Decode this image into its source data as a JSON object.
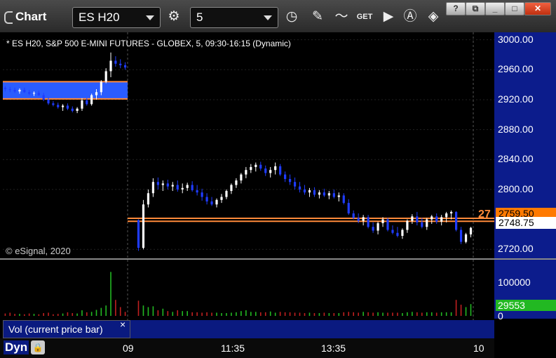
{
  "titlebar": {
    "title": "Chart",
    "symbol": "ES H20",
    "interval": "5",
    "icons": [
      "settings-gear-icon",
      "clock-icon",
      "pencil-icon",
      "studies-icon",
      "get-icon",
      "play-icon",
      "alert-icon",
      "tag-icon"
    ],
    "help_label": "?",
    "window_buttons": [
      "restore",
      "minimize",
      "maximize",
      "close"
    ]
  },
  "chart": {
    "description": "* ES H20, S&P 500 E-MINI FUTURES - GLOBEX, 5, 09:30-16:15 (Dynamic)",
    "copyright": "© eSignal, 2020",
    "price_axis": [
      "3000.00",
      "2960.00",
      "2920.00",
      "2880.00",
      "2840.00",
      "2800.00",
      "2720.00"
    ],
    "price_range": [
      2708,
      3010
    ],
    "last_price": "2748.75",
    "orange_label": "2759.50",
    "orange_left_label": "27",
    "volume_axis": [
      "100000",
      "0"
    ],
    "volume_range": [
      0,
      130000
    ],
    "volume_last": "29553",
    "time_labels": [
      "09",
      "11:35",
      "13:35",
      "10"
    ],
    "vol_panel_label": "Vol (current price bar)",
    "vol_close": "×",
    "dyn_label": "Dyn",
    "colors": {
      "up": "#ffffff",
      "down": "#1f3cff",
      "vol_up": "#22b822",
      "vol_down": "#c02020",
      "zone": "#2a5cff",
      "line": "#ff8a3a"
    }
  },
  "chart_data": {
    "type": "candlestick",
    "series": [
      {
        "name": "day1",
        "candles": [
          [
            2936,
            2938,
            2931,
            2934
          ],
          [
            2934,
            2937,
            2930,
            2933
          ],
          [
            2933,
            2936,
            2929,
            2931
          ],
          [
            2931,
            2935,
            2928,
            2933
          ],
          [
            2933,
            2936,
            2929,
            2930
          ],
          [
            2930,
            2933,
            2926,
            2928
          ],
          [
            2928,
            2931,
            2925,
            2929
          ],
          [
            2929,
            2932,
            2925,
            2926
          ],
          [
            2926,
            2929,
            2918,
            2920
          ],
          [
            2920,
            2923,
            2913,
            2915
          ],
          [
            2915,
            2918,
            2911,
            2913
          ],
          [
            2913,
            2916,
            2908,
            2910
          ],
          [
            2910,
            2914,
            2905,
            2912
          ],
          [
            2912,
            2915,
            2906,
            2908
          ],
          [
            2908,
            2911,
            2903,
            2905
          ],
          [
            2905,
            2910,
            2902,
            2908
          ],
          [
            2908,
            2922,
            2905,
            2919
          ],
          [
            2919,
            2922,
            2912,
            2914
          ],
          [
            2914,
            2928,
            2912,
            2926
          ],
          [
            2926,
            2934,
            2920,
            2930
          ],
          [
            2930,
            2946,
            2926,
            2944
          ],
          [
            2944,
            2962,
            2942,
            2958
          ],
          [
            2958,
            2983,
            2950,
            2972
          ],
          [
            2972,
            2978,
            2964,
            2968
          ],
          [
            2968,
            2974,
            2962,
            2966
          ],
          [
            2966,
            2970,
            2960,
            2963
          ]
        ]
      },
      {
        "name": "day2",
        "candles": [
          [
            2759,
            2760,
            2718,
            2722
          ],
          [
            2722,
            2786,
            2720,
            2780
          ],
          [
            2780,
            2800,
            2776,
            2795
          ],
          [
            2795,
            2815,
            2790,
            2810
          ],
          [
            2810,
            2816,
            2800,
            2806
          ],
          [
            2806,
            2812,
            2798,
            2808
          ],
          [
            2808,
            2813,
            2800,
            2804
          ],
          [
            2804,
            2810,
            2798,
            2806
          ],
          [
            2806,
            2812,
            2797,
            2800
          ],
          [
            2800,
            2808,
            2795,
            2802
          ],
          [
            2802,
            2809,
            2798,
            2806
          ],
          [
            2806,
            2811,
            2797,
            2799
          ],
          [
            2799,
            2806,
            2792,
            2796
          ],
          [
            2796,
            2801,
            2785,
            2790
          ],
          [
            2790,
            2795,
            2780,
            2784
          ],
          [
            2784,
            2790,
            2778,
            2780
          ],
          [
            2780,
            2788,
            2776,
            2786
          ],
          [
            2786,
            2794,
            2782,
            2790
          ],
          [
            2790,
            2800,
            2787,
            2798
          ],
          [
            2798,
            2808,
            2794,
            2806
          ],
          [
            2806,
            2815,
            2802,
            2812
          ],
          [
            2812,
            2822,
            2808,
            2820
          ],
          [
            2820,
            2830,
            2815,
            2826
          ],
          [
            2826,
            2834,
            2822,
            2830
          ],
          [
            2830,
            2836,
            2824,
            2833
          ],
          [
            2833,
            2837,
            2825,
            2828
          ],
          [
            2828,
            2832,
            2818,
            2822
          ],
          [
            2822,
            2830,
            2816,
            2826
          ],
          [
            2826,
            2836,
            2820,
            2831
          ],
          [
            2831,
            2834,
            2818,
            2820
          ],
          [
            2820,
            2824,
            2810,
            2814
          ],
          [
            2814,
            2820,
            2806,
            2810
          ],
          [
            2810,
            2816,
            2800,
            2804
          ],
          [
            2804,
            2810,
            2796,
            2800
          ],
          [
            2800,
            2806,
            2793,
            2796
          ],
          [
            2796,
            2802,
            2790,
            2799
          ],
          [
            2799,
            2803,
            2790,
            2793
          ],
          [
            2793,
            2799,
            2788,
            2796
          ],
          [
            2796,
            2801,
            2790,
            2792
          ],
          [
            2792,
            2798,
            2787,
            2795
          ],
          [
            2795,
            2800,
            2788,
            2790
          ],
          [
            2790,
            2796,
            2784,
            2792
          ],
          [
            2792,
            2795,
            2780,
            2782
          ],
          [
            2782,
            2787,
            2766,
            2768
          ],
          [
            2768,
            2772,
            2760,
            2762
          ],
          [
            2762,
            2768,
            2755,
            2758
          ],
          [
            2758,
            2766,
            2752,
            2763
          ],
          [
            2763,
            2766,
            2748,
            2750
          ],
          [
            2750,
            2756,
            2742,
            2745
          ],
          [
            2745,
            2757,
            2740,
            2755
          ],
          [
            2755,
            2763,
            2750,
            2760
          ],
          [
            2760,
            2762,
            2744,
            2746
          ],
          [
            2746,
            2752,
            2740,
            2742
          ],
          [
            2742,
            2750,
            2736,
            2738
          ],
          [
            2738,
            2748,
            2734,
            2746
          ],
          [
            2746,
            2760,
            2742,
            2758
          ],
          [
            2758,
            2767,
            2754,
            2764
          ],
          [
            2764,
            2770,
            2752,
            2756
          ],
          [
            2756,
            2762,
            2748,
            2750
          ],
          [
            2750,
            2762,
            2746,
            2760
          ],
          [
            2760,
            2766,
            2754,
            2764
          ],
          [
            2764,
            2768,
            2754,
            2757
          ],
          [
            2757,
            2766,
            2752,
            2763
          ],
          [
            2763,
            2770,
            2756,
            2768
          ],
          [
            2768,
            2772,
            2760,
            2770
          ],
          [
            2770,
            2771,
            2744,
            2746
          ],
          [
            2746,
            2750,
            2727,
            2730
          ],
          [
            2730,
            2742,
            2728,
            2740
          ],
          [
            2740,
            2750,
            2736,
            2748.75
          ]
        ]
      }
    ],
    "volume": {
      "day1": [
        6000,
        8000,
        5000,
        5000,
        4000,
        6000,
        5000,
        4000,
        7000,
        8000,
        4000,
        5000,
        6000,
        9000,
        7000,
        6000,
        14000,
        9000,
        10000,
        15000,
        20000,
        26000,
        110000,
        40000,
        22000,
        10000
      ],
      "day2": [
        38000,
        26000,
        22000,
        24000,
        14000,
        18000,
        12000,
        10000,
        14000,
        12000,
        12000,
        9000,
        9000,
        8000,
        9000,
        8000,
        8000,
        7000,
        7000,
        8000,
        9000,
        12000,
        14000,
        10000,
        10000,
        9000,
        9000,
        11000,
        8000,
        10000,
        9000,
        9000,
        8000,
        8000,
        7000,
        8000,
        7000,
        7000,
        8000,
        7000,
        7000,
        7000,
        9000,
        10000,
        9000,
        8000,
        10000,
        9000,
        8000,
        9000,
        8000,
        8000,
        8000,
        8000,
        7000,
        9000,
        10000,
        9000,
        8000,
        9000,
        9000,
        8000,
        9000,
        9000,
        9000,
        40000,
        28000,
        22000,
        29553
      ]
    },
    "ylim": [
      2708,
      3010
    ]
  }
}
